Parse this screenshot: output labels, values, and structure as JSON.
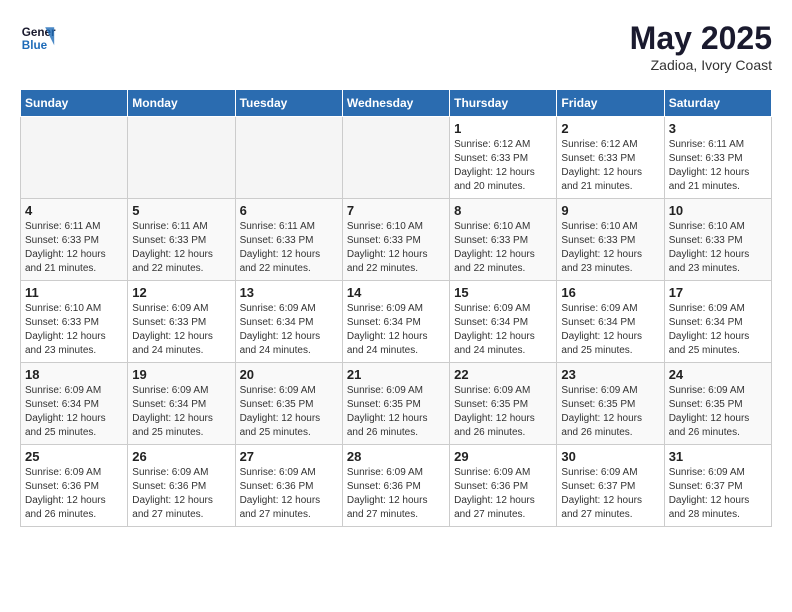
{
  "header": {
    "logo_line1": "General",
    "logo_line2": "Blue",
    "main_title": "May 2025",
    "subtitle": "Zadioa, Ivory Coast"
  },
  "days_of_week": [
    "Sunday",
    "Monday",
    "Tuesday",
    "Wednesday",
    "Thursday",
    "Friday",
    "Saturday"
  ],
  "weeks": [
    [
      {
        "num": "",
        "info": ""
      },
      {
        "num": "",
        "info": ""
      },
      {
        "num": "",
        "info": ""
      },
      {
        "num": "",
        "info": ""
      },
      {
        "num": "1",
        "info": "Sunrise: 6:12 AM\nSunset: 6:33 PM\nDaylight: 12 hours\nand 20 minutes."
      },
      {
        "num": "2",
        "info": "Sunrise: 6:12 AM\nSunset: 6:33 PM\nDaylight: 12 hours\nand 21 minutes."
      },
      {
        "num": "3",
        "info": "Sunrise: 6:11 AM\nSunset: 6:33 PM\nDaylight: 12 hours\nand 21 minutes."
      }
    ],
    [
      {
        "num": "4",
        "info": "Sunrise: 6:11 AM\nSunset: 6:33 PM\nDaylight: 12 hours\nand 21 minutes."
      },
      {
        "num": "5",
        "info": "Sunrise: 6:11 AM\nSunset: 6:33 PM\nDaylight: 12 hours\nand 22 minutes."
      },
      {
        "num": "6",
        "info": "Sunrise: 6:11 AM\nSunset: 6:33 PM\nDaylight: 12 hours\nand 22 minutes."
      },
      {
        "num": "7",
        "info": "Sunrise: 6:10 AM\nSunset: 6:33 PM\nDaylight: 12 hours\nand 22 minutes."
      },
      {
        "num": "8",
        "info": "Sunrise: 6:10 AM\nSunset: 6:33 PM\nDaylight: 12 hours\nand 22 minutes."
      },
      {
        "num": "9",
        "info": "Sunrise: 6:10 AM\nSunset: 6:33 PM\nDaylight: 12 hours\nand 23 minutes."
      },
      {
        "num": "10",
        "info": "Sunrise: 6:10 AM\nSunset: 6:33 PM\nDaylight: 12 hours\nand 23 minutes."
      }
    ],
    [
      {
        "num": "11",
        "info": "Sunrise: 6:10 AM\nSunset: 6:33 PM\nDaylight: 12 hours\nand 23 minutes."
      },
      {
        "num": "12",
        "info": "Sunrise: 6:09 AM\nSunset: 6:33 PM\nDaylight: 12 hours\nand 24 minutes."
      },
      {
        "num": "13",
        "info": "Sunrise: 6:09 AM\nSunset: 6:34 PM\nDaylight: 12 hours\nand 24 minutes."
      },
      {
        "num": "14",
        "info": "Sunrise: 6:09 AM\nSunset: 6:34 PM\nDaylight: 12 hours\nand 24 minutes."
      },
      {
        "num": "15",
        "info": "Sunrise: 6:09 AM\nSunset: 6:34 PM\nDaylight: 12 hours\nand 24 minutes."
      },
      {
        "num": "16",
        "info": "Sunrise: 6:09 AM\nSunset: 6:34 PM\nDaylight: 12 hours\nand 25 minutes."
      },
      {
        "num": "17",
        "info": "Sunrise: 6:09 AM\nSunset: 6:34 PM\nDaylight: 12 hours\nand 25 minutes."
      }
    ],
    [
      {
        "num": "18",
        "info": "Sunrise: 6:09 AM\nSunset: 6:34 PM\nDaylight: 12 hours\nand 25 minutes."
      },
      {
        "num": "19",
        "info": "Sunrise: 6:09 AM\nSunset: 6:34 PM\nDaylight: 12 hours\nand 25 minutes."
      },
      {
        "num": "20",
        "info": "Sunrise: 6:09 AM\nSunset: 6:35 PM\nDaylight: 12 hours\nand 25 minutes."
      },
      {
        "num": "21",
        "info": "Sunrise: 6:09 AM\nSunset: 6:35 PM\nDaylight: 12 hours\nand 26 minutes."
      },
      {
        "num": "22",
        "info": "Sunrise: 6:09 AM\nSunset: 6:35 PM\nDaylight: 12 hours\nand 26 minutes."
      },
      {
        "num": "23",
        "info": "Sunrise: 6:09 AM\nSunset: 6:35 PM\nDaylight: 12 hours\nand 26 minutes."
      },
      {
        "num": "24",
        "info": "Sunrise: 6:09 AM\nSunset: 6:35 PM\nDaylight: 12 hours\nand 26 minutes."
      }
    ],
    [
      {
        "num": "25",
        "info": "Sunrise: 6:09 AM\nSunset: 6:36 PM\nDaylight: 12 hours\nand 26 minutes."
      },
      {
        "num": "26",
        "info": "Sunrise: 6:09 AM\nSunset: 6:36 PM\nDaylight: 12 hours\nand 27 minutes."
      },
      {
        "num": "27",
        "info": "Sunrise: 6:09 AM\nSunset: 6:36 PM\nDaylight: 12 hours\nand 27 minutes."
      },
      {
        "num": "28",
        "info": "Sunrise: 6:09 AM\nSunset: 6:36 PM\nDaylight: 12 hours\nand 27 minutes."
      },
      {
        "num": "29",
        "info": "Sunrise: 6:09 AM\nSunset: 6:36 PM\nDaylight: 12 hours\nand 27 minutes."
      },
      {
        "num": "30",
        "info": "Sunrise: 6:09 AM\nSunset: 6:37 PM\nDaylight: 12 hours\nand 27 minutes."
      },
      {
        "num": "31",
        "info": "Sunrise: 6:09 AM\nSunset: 6:37 PM\nDaylight: 12 hours\nand 28 minutes."
      }
    ]
  ]
}
